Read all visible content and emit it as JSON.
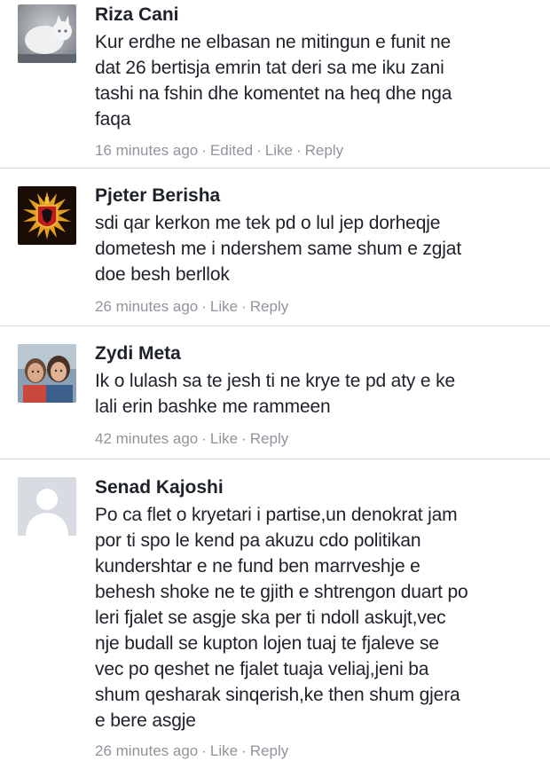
{
  "comments": [
    {
      "author": "Riza Cani",
      "avatar_icon": "cat-photo-avatar",
      "text": "Kur erdhe ne elbasan ne mitingun e funit ne\ndat 26 bertisja emrin tat deri sa me iku zani\ntashi na fshin dhe komentet  na heq dhe nga\nfaqa",
      "time": "16 minutes ago",
      "edited": "Edited",
      "like": "Like",
      "reply": "Reply",
      "separator": "·"
    },
    {
      "author": "Pjeter Berisha",
      "avatar_icon": "eagle-emblem-avatar",
      "text": "sdi qar kerkon me tek pd o lul jep dorheqje\ndometesh me i ndershem same shum e zgjat\ndoe besh berllok",
      "time": "26 minutes ago",
      "like": "Like",
      "reply": "Reply",
      "separator": "·"
    },
    {
      "author": "Zydi Meta",
      "avatar_icon": "two-children-photo-avatar",
      "text": "Ik o lulash sa te jesh ti ne krye te pd aty e ke\nlali erin bashke me rammeen",
      "time": "42 minutes ago",
      "like": "Like",
      "reply": "Reply",
      "separator": "·"
    },
    {
      "author": "Senad Kajoshi",
      "avatar_icon": "default-user-silhouette-avatar",
      "text": "Po ca flet o kryetari i partise,un denokrat jam\npor ti spo le kend pa akuzu cdo politikan\nkundershtar e ne fund ben marrveshje e\nbehesh shoke ne te gjith e shtrengon duart po\nleri fjalet se asgje ska per ti ndoll askujt,vec\nnje budall se kupton lojen tuaj te fjaleve se\nvec po qeshet ne fjalet tuaja veliaj,jeni ba\nshum qesharak sinqerish,ke then shum gjera\ne bere asgje",
      "time": "26 minutes ago",
      "like": "Like",
      "reply": "Reply",
      "separator": "·"
    }
  ]
}
